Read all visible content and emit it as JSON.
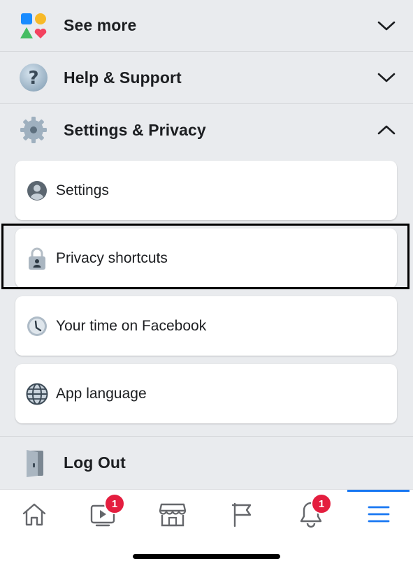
{
  "sections": {
    "see_more": {
      "label": "See more"
    },
    "help_support": {
      "label": "Help & Support"
    },
    "settings_privacy": {
      "label": "Settings & Privacy"
    },
    "log_out": {
      "label": "Log Out"
    }
  },
  "settings_items": [
    {
      "label": "Settings",
      "icon": "account-circle-icon"
    },
    {
      "label": "Privacy shortcuts",
      "icon": "lock-icon"
    },
    {
      "label": "Your time on Facebook",
      "icon": "clock-icon"
    },
    {
      "label": "App language",
      "icon": "globe-icon"
    }
  ],
  "tabbar": {
    "tabs": [
      {
        "name": "home",
        "icon": "home-icon"
      },
      {
        "name": "watch",
        "icon": "video-icon",
        "badge": "1"
      },
      {
        "name": "marketplace",
        "icon": "store-icon"
      },
      {
        "name": "pages",
        "icon": "flag-icon"
      },
      {
        "name": "notifications",
        "icon": "bell-icon",
        "badge": "1"
      },
      {
        "name": "menu",
        "icon": "hamburger-icon",
        "active": true
      }
    ]
  },
  "colors": {
    "accent": "#1877f2",
    "badge": "#e41e3f",
    "background": "#e9ebee",
    "card": "#ffffff"
  }
}
